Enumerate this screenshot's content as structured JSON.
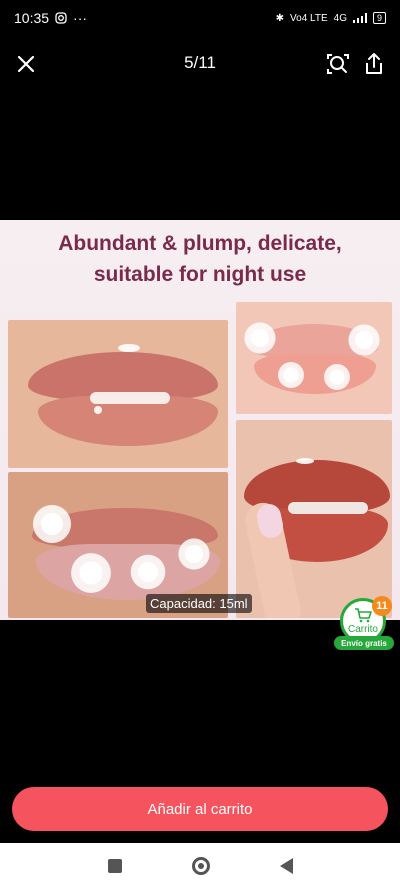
{
  "status_bar": {
    "time": "10:35",
    "network_text": "Vo4 LTE",
    "signal_text": "4G",
    "battery": "9"
  },
  "header": {
    "counter": "5/11"
  },
  "product_image": {
    "headline_line1": "Abundant & plump, delicate,",
    "headline_line2": "suitable for night use",
    "capacity_label": "Capacidad: 15ml"
  },
  "cart": {
    "count": "11",
    "label": "Carrito",
    "free_shipping": "Envío gratis"
  },
  "actions": {
    "add_to_cart": "Añadir al carrito"
  },
  "colors": {
    "accent": "#f5535e",
    "cart_green": "#27a83a",
    "headline": "#7a2a4a"
  }
}
